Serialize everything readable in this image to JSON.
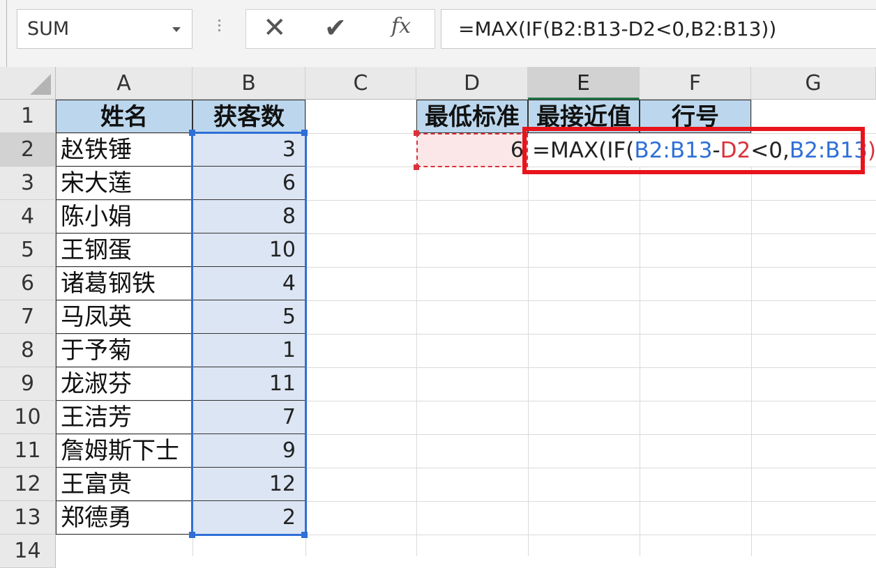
{
  "toolbar": {
    "name_box": "SUM",
    "cancel_glyph": "✕",
    "enter_glyph": "✔",
    "fx_label": "fx",
    "formula": "=MAX(IF(B2:B13-D2<0,B2:B13))"
  },
  "columns": [
    "A",
    "B",
    "C",
    "D",
    "E",
    "F",
    "G"
  ],
  "rows": [
    "1",
    "2",
    "3",
    "4",
    "5",
    "6",
    "7",
    "8",
    "9",
    "10",
    "11",
    "12",
    "13",
    "14"
  ],
  "headers": {
    "A1": "姓名",
    "B1": "获客数",
    "D1": "最低标准",
    "E1": "最接近值",
    "F1": "行号"
  },
  "names": [
    "赵铁锤",
    "宋大莲",
    "陈小娟",
    "王钢蛋",
    "诸葛钢铁",
    "马凤英",
    "于予菊",
    "龙淑芬",
    "王洁芳",
    "詹姆斯下士",
    "王富贵",
    "郑德勇"
  ],
  "counts": [
    "3",
    "6",
    "8",
    "10",
    "4",
    "5",
    "1",
    "11",
    "7",
    "9",
    "12",
    "2"
  ],
  "d2_value": "6",
  "edit_formula": {
    "p1": "=MAX(IF(",
    "p2": "B2:B13",
    "p3": "-",
    "p4": "D2",
    "p5": "<0,",
    "p6": "B2:B13",
    "p7": ")",
    "p8": ")"
  },
  "colors": {
    "header_fill": "#bcd7ed",
    "range_fill": "#dbe5f3",
    "range_blue": "#2f6fd6",
    "ref_red": "#d8333a",
    "annotation_red": "#e8141c"
  }
}
